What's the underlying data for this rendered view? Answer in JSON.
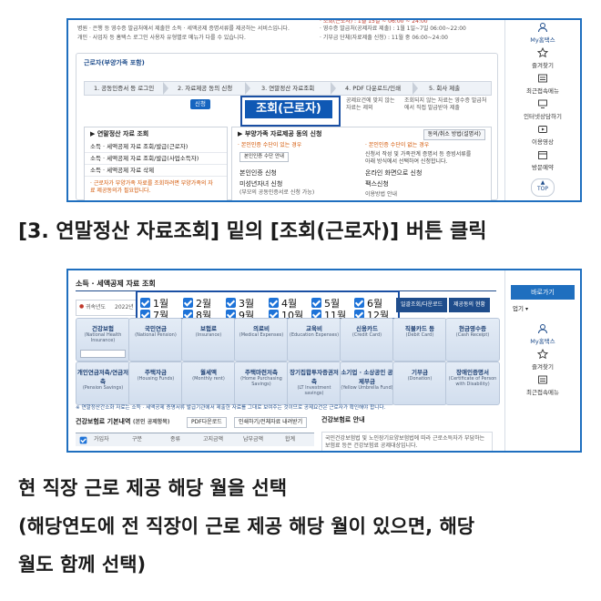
{
  "screenshot1": {
    "notice_left": [
      "병원 · 은행 등 영수증 발급처에서 제출한 소득 · 세액공제 증명서류를 제공하는 서비스입니다.",
      "개인 · 사업자 등 홈택스 로그인 사용자 유형별로 메뉴가 다를 수 있습니다."
    ],
    "notice_right": [
      "· 조회(근로자) : 1월 15일 ~ 06:00 ~ 24:00",
      "· 영수증 발급처(공제자료 제출) : 1월 1일~7일 06:00~22:00",
      "· 기부금 단체(자료제출 신청) : 11월 중 06:00~24:00"
    ],
    "section_title": "근로자(부양가족 포함)",
    "steps": [
      "1. 공동인증서 등 로그인",
      "2. 자료제공 동의 신청",
      "3. 연말정산 자료조회",
      "4. PDF 다운로드/인쇄",
      "5. 회사 제출"
    ],
    "apply_button": "신청",
    "lookup_button": "조회(근로자)",
    "small_note_a": "공제요건에 맞지 않는 자료는 제외",
    "small_note_b": "조회되지 않는 자료는 영수증 발급처에서 직접 발급받아 제출",
    "panel_left_title": "▶ 연말정산 자료 조회",
    "panel_left_items": [
      "소득 · 세액공제 자료 조회/발급(근로자)",
      "소득 · 세액공제 자료 조회/발급(사업소득자)",
      "소득 · 세액공제 자료 삭제"
    ],
    "panel_left_note": "· 근로자가 부양가족 자료를 조회하려면 부양가족의 자료 제공동의가 필요합니다.",
    "panel_right_title": "▶ 부양가족 자료제공 동의 신청",
    "panel_right_button": "동의/취소 방법(설명서)",
    "panel_right_col1_title": "· 본인인증 수단이 있는 경우",
    "panel_right_col2_title": "· 본인인증 수단이 없는 경우",
    "panel_right_col1_btn": "본인인증 수단 안내",
    "panel_right_col2_text": "신청서 작성 및 가족관계 증명서 등 증빙서류를 아래 방식에서 선택하여 신청합니다.",
    "panel_right_rows": [
      [
        "본인인증 신청",
        "온라인 화면으로 신청"
      ],
      [
        "미성년자녀 신청",
        "팩스신청"
      ],
      [
        "(부모의 공동인증서로 신청 가능)",
        "이용방법 안내"
      ]
    ],
    "rightbar": [
      "My홈택스",
      "즐겨찾기",
      "최근접속메뉴",
      "인터넷상담하기",
      "이용영상",
      "방문예약",
      "TOP"
    ]
  },
  "caption1": "[3. 연말정산 자료조회] 밑의 [조회(근로자)] 버튼 클릭",
  "screenshot2": {
    "title": "소득 · 세액공제 자료 조회",
    "year_label": "귀속년도",
    "year_value": "2022년",
    "month_row1": [
      "1월",
      "2월",
      "3월",
      "4월",
      "5월",
      "6월"
    ],
    "month_row2": [
      "7월",
      "8월",
      "9월",
      "10월",
      "11월",
      "12월"
    ],
    "btn_download": "일괄조회/다운로드",
    "btn_status": "제공동의 현황",
    "cards_row1": [
      [
        "건강보험",
        "(National Health Insurance)"
      ],
      [
        "국민연금",
        "(National Pension)"
      ],
      [
        "보험료",
        "(Insurance)"
      ],
      [
        "의료비",
        "(Medical Expenses)"
      ],
      [
        "교육비",
        "(Education Expenses)"
      ],
      [
        "신용카드",
        "(Credit Card)"
      ],
      [
        "직불카드 등",
        "(Debit Card)"
      ],
      [
        "현금영수증",
        "(Cash Receipt)"
      ]
    ],
    "cards_row2": [
      [
        "개인연금저축/연금저축",
        "(Pension Savings)"
      ],
      [
        "주택자금",
        "(Housing Funds)"
      ],
      [
        "월세액",
        "(Monthly rent)"
      ],
      [
        "주택마련저축",
        "(Home Purchasing Savings)"
      ],
      [
        "장기집합투자증권저축",
        "(LT Investment savings)"
      ],
      [
        "소기업 · 소상공인 공제부금",
        "(Yellow Umbrella Fund)"
      ],
      [
        "기부금",
        "(Donation)"
      ],
      [
        "장애인증명서",
        "(Certificate of Person with Disability)"
      ]
    ],
    "warning": "※ 연말정산간소화 자료는 소득 · 세액공제 증명서류 발급기관에서 제출한 자료를 그대로 보여주는 것이므로 공제요건은 근로자가 확인해야 합니다.",
    "table_title": "건강보험료 기본내역",
    "table_title_unit": "(본인 공제항목)",
    "table_btn1": "PDF다운로드",
    "table_btn2": "인쇄하기/전체자료 내려받기",
    "table_headers": [
      "가입자",
      "구분",
      "종류",
      "고지금액",
      "납부금액",
      "합계"
    ],
    "side_title": "건강보험료 안내",
    "side_text": "국민건강보험법 및 노인장기요양보험법에 따라 근로소득자가 부담하는 보험료 등은 건강보험료 공제대상입니다.",
    "rightbar_title": "바로가기",
    "rightbar_select": "업기",
    "rightbar": [
      "My홈택스",
      "즐겨찾기",
      "최근접속메뉴"
    ]
  },
  "caption2_lines": [
    "현 직장 근로 제공 해당 월을 선택",
    "(해당연도에 전 직장이 근로 제공 해당 월이 있으면, 해당",
    "월도 함께 선택)"
  ],
  "colors": {
    "accent": "#1f6fbf",
    "highlight_box": "#1a4fa3",
    "lookup_bg": "#0f58b4",
    "caption": "#1b1b1b"
  }
}
